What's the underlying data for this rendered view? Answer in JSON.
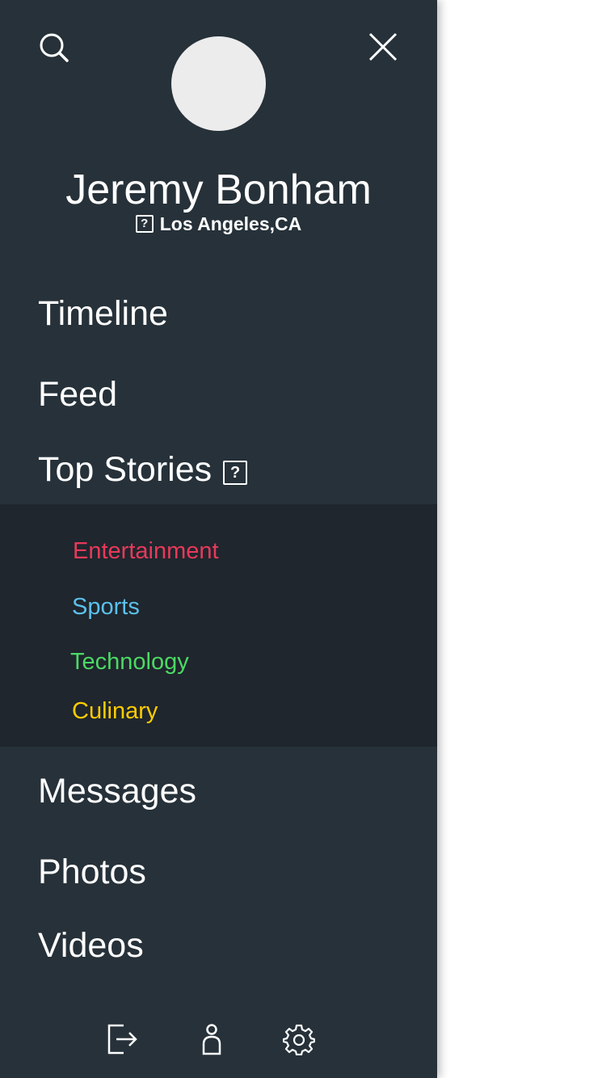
{
  "profile": {
    "name": "Jeremy Bonham",
    "location": "Los Angeles,CA",
    "location_icon": "?"
  },
  "nav": {
    "timeline": "Timeline",
    "feed": "Feed",
    "top_stories": "Top Stories",
    "top_stories_icon": "?",
    "messages": "Messages",
    "photos": "Photos",
    "videos": "Videos"
  },
  "submenu": [
    {
      "label": "Entertainment",
      "color": "#e8395b"
    },
    {
      "label": "Sports",
      "color": "#5bc0eb"
    },
    {
      "label": "Technology",
      "color": "#4cd964"
    },
    {
      "label": "Culinary",
      "color": "#ffcc00"
    }
  ],
  "icons": {
    "search": "search-icon",
    "close": "close-icon",
    "logout": "logout-icon",
    "profile": "user-icon",
    "settings": "gear-icon"
  },
  "colors": {
    "drawer_bg": "#263139",
    "submenu_bg": "#1f262d",
    "avatar": "#ececec"
  }
}
